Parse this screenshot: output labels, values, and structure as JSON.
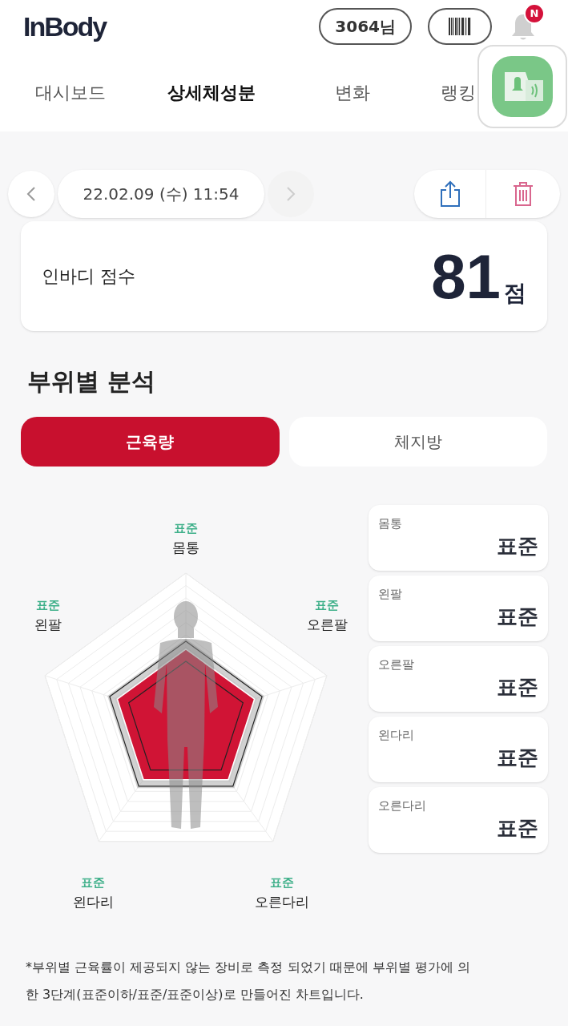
{
  "header": {
    "logo": "InBody",
    "user_badge": "3064님",
    "notification_badge": "N"
  },
  "tabs": [
    {
      "label": "대시보드",
      "selected": false
    },
    {
      "label": "상세체성분",
      "selected": true
    },
    {
      "label": "변화",
      "selected": false
    },
    {
      "label": "랭킹",
      "selected": false
    }
  ],
  "date_nav": {
    "date": "22.02.09 (수) 11:54"
  },
  "score_card": {
    "label": "인바디 점수",
    "score": "81",
    "unit": "점"
  },
  "section_title": "부위별 분석",
  "toggle": [
    {
      "label": "근육량",
      "selected": true
    },
    {
      "label": "체지방",
      "selected": false
    }
  ],
  "radar_labels": [
    {
      "status": "표준",
      "part": "몸통"
    },
    {
      "status": "표준",
      "part": "왼팔"
    },
    {
      "status": "표준",
      "part": "오른팔"
    },
    {
      "status": "표준",
      "part": "왼다리"
    },
    {
      "status": "표준",
      "part": "오른다리"
    }
  ],
  "segment_cards": [
    {
      "part": "몸통",
      "status": "표준"
    },
    {
      "part": "왼팔",
      "status": "표준"
    },
    {
      "part": "오른팔",
      "status": "표준"
    },
    {
      "part": "왼다리",
      "status": "표준"
    },
    {
      "part": "오른다리",
      "status": "표준"
    }
  ],
  "footnote": "*부위별 근육률이 제공되지 않는 장비로 측정 되었기 때문에 부위별 평가에 의한 3단계(표준이하/표준/표준이상)로 만들어진 차트입니다."
}
